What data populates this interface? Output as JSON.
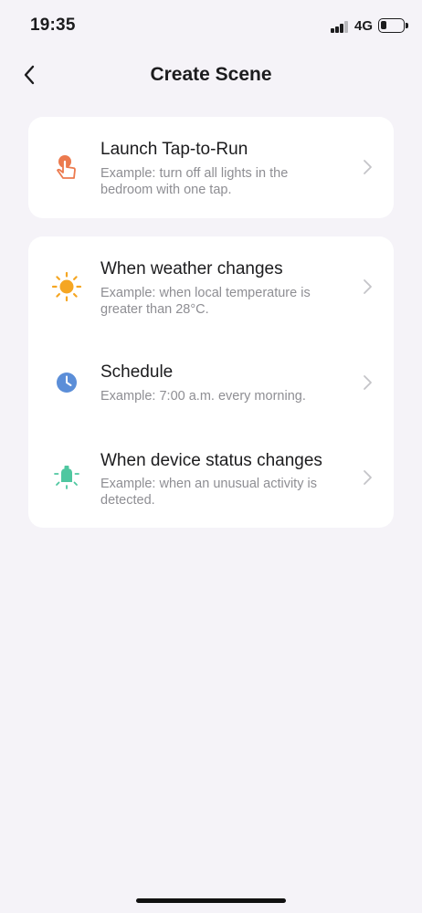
{
  "status_bar": {
    "time": "19:35",
    "network": "4G",
    "icons": [
      "signal-icon",
      "battery-icon"
    ]
  },
  "nav": {
    "title": "Create Scene",
    "back_icon": "chevron-left-icon"
  },
  "options": [
    {
      "title": "Launch Tap-to-Run",
      "description": "Example: turn off all lights in the bedroom with one tap.",
      "icon": "tap-hand-icon",
      "color": "#ec7a4e"
    },
    {
      "title": "When weather changes",
      "description": "Example: when local temperature is greater than 28°C.",
      "icon": "sun-icon",
      "color": "#f5a623"
    },
    {
      "title": "Schedule",
      "description": "Example: 7:00 a.m. every morning.",
      "icon": "clock-icon",
      "color": "#5b8ed8"
    },
    {
      "title": "When device status changes",
      "description": "Example: when an unusual activity is detected.",
      "icon": "device-bulb-icon",
      "color": "#4fc7a0"
    }
  ]
}
